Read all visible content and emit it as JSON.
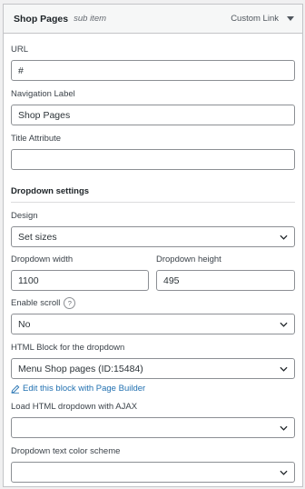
{
  "header": {
    "title": "Shop Pages",
    "sub": "sub item",
    "type": "Custom Link"
  },
  "fields": {
    "url": {
      "label": "URL",
      "value": "#"
    },
    "nav_label": {
      "label": "Navigation Label",
      "value": "Shop Pages"
    },
    "title_attr": {
      "label": "Title Attribute",
      "value": ""
    }
  },
  "dropdown": {
    "section_title": "Dropdown settings",
    "design": {
      "label": "Design",
      "value": "Set sizes"
    },
    "width": {
      "label": "Dropdown width",
      "value": "1100"
    },
    "height": {
      "label": "Dropdown height",
      "value": "495"
    },
    "scroll": {
      "label": "Enable scroll",
      "help": "?",
      "value": "No"
    },
    "html_block": {
      "label": "HTML Block for the dropdown",
      "value": "Menu Shop pages (ID:15484)"
    },
    "edit_link": "Edit this block with Page Builder",
    "ajax": {
      "label": "Load HTML dropdown with AJAX",
      "value": ""
    },
    "color_scheme": {
      "label": "Dropdown text color scheme",
      "value": ""
    }
  }
}
